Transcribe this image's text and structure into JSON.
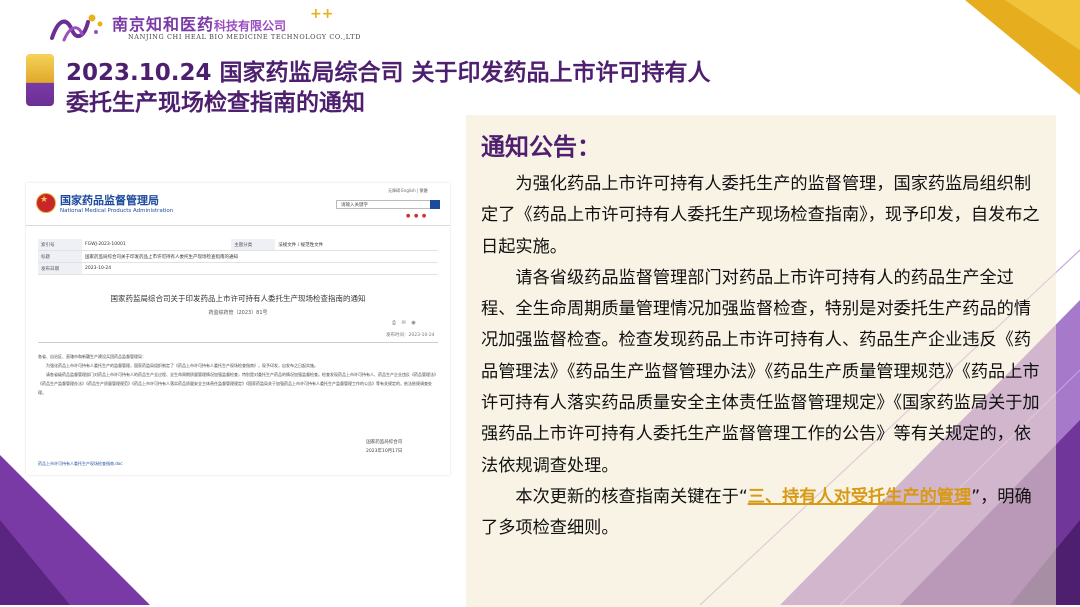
{
  "colors": {
    "brand_purple": "#4d1f6e",
    "accent_gold": "#e7b21a",
    "panel_bg": "#f4ead2",
    "site_blue": "#1c4a9c"
  },
  "header": {
    "company_cn": "南京知和医药",
    "company_cn_suffix": "科技有限公司",
    "company_plus": "++",
    "company_en": "NANJING CHI HEAL BIO MEDICINE TECHNOLOGY CO.,LTD",
    "logo_icon": "molecule-logo-icon"
  },
  "title": {
    "line1": "2023.10.24 国家药监局综合司 关于印发药品上市许可持有人",
    "line2": "委托生产现场检查指南的通知"
  },
  "website": {
    "emblem_icon": "national-emblem-icon",
    "name_cn": "国家药品监督管理局",
    "name_en": "National Medical Products Administration",
    "top_links": "无障碍  English  |  繁體",
    "search_placeholder": "请输入关键字",
    "table": [
      {
        "k1": "索引号",
        "v1": "FGWJ-2023-10001",
        "k2": "主题分类",
        "v2": "法规文件 / 规范性文件"
      },
      {
        "k1": "标题",
        "v1": "国家药监局综合司关于印发药品上市许可持有人委托生产现场检查指南的通知",
        "k2": "",
        "v2": ""
      },
      {
        "k1": "发布日期",
        "v1": "2023-10-24",
        "k2": "",
        "v2": ""
      }
    ],
    "doc_title": "国家药监局综合司关于印发药品上市许可持有人委托生产现场检查指南的通知",
    "doc_number": "药监综药管〔2023〕81号",
    "doc_date": "发布时间：2023-10-24",
    "doc_body": [
      "各省、自治区、直辖市和新疆生产建设兵团药品监督管理局：",
      "为强化药品上市许可持有人委托生产的监督管理，国家药监局组织制定了《药品上市许可持有人委托生产现场检查指南》，现予印发，自发布之日起实施。",
      "请各省级药品监督管理部门对药品上市许可持有人的药品生产全过程、全生命周期质量管理情况加强监督检查，特别是对委托生产药品的情况加强监督检查。检查发现药品上市许可持有人、药品生产企业违反《药品管理法》《药品生产监督管理办法》《药品生产质量管理规范》《药品上市许可持有人落实药品质量安全主体责任监督管理规定》《国家药监局关于加强药品上市许可持有人委托生产监督管理工作的公告》等有关规定的，依法依规调查处理。"
    ],
    "sign_org": "国家药监局综合司",
    "sign_date": "2023年10月17日",
    "attachment": "药品上市许可持有人委托生产现场检查指南.doc"
  },
  "notice": {
    "heading": "通知公告：",
    "p1": "为强化药品上市许可持有人委托生产的监督管理，国家药监局组织制定了《药品上市许可持有人委托生产现场检查指南》，现予印发，自发布之日起实施。",
    "p2": "请各省级药品监督管理部门对药品上市许可持有人的药品生产全过程、全生命周期质量管理情况加强监督检查，特别是对委托生产药品的情况加强监督检查。检查发现药品上市许可持有人、药品生产企业违反《药品管理法》《药品生产监督管理办法》《药品生产质量管理规范》《药品上市许可持有人落实药品质量安全主体责任监督管理规定》《国家药监局关于加强药品上市许可持有人委托生产监督管理工作的公告》等有关规定的，依法依规调查处理。",
    "p3_pre": "本次更新的核查指南关键在于“",
    "p3_highlight": "三、持有人对受托生产的管理",
    "p3_post": "”，明确了多项检查细则。"
  }
}
